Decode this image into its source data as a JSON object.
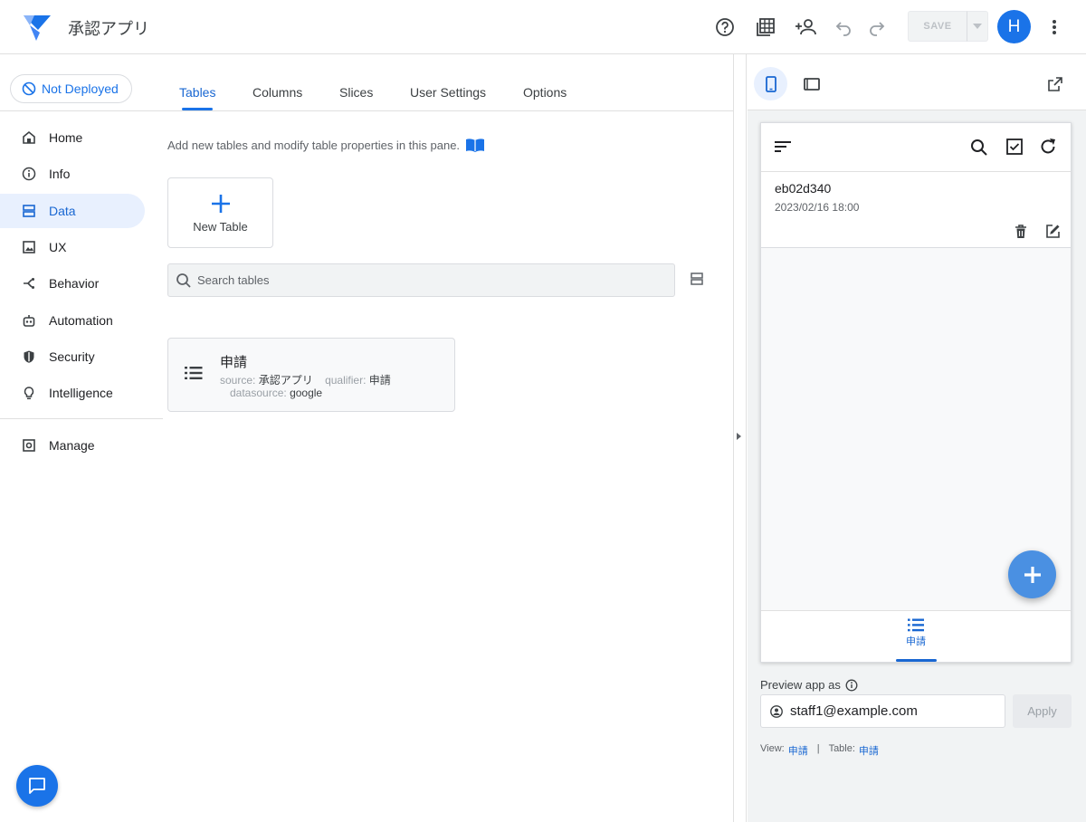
{
  "app": {
    "title": "承認アプリ"
  },
  "topbar": {
    "icons": [
      "help-icon",
      "table-grid-icon",
      "add-person-icon",
      "undo-icon",
      "redo-icon"
    ],
    "save_label": "SAVE",
    "avatar_initial": "H"
  },
  "sidebar": {
    "deploy_status": "Not Deployed",
    "items": [
      {
        "label": "Home",
        "icon": "home-icon"
      },
      {
        "label": "Info",
        "icon": "info-icon"
      },
      {
        "label": "Data",
        "icon": "data-icon",
        "active": true
      },
      {
        "label": "UX",
        "icon": "image-icon"
      },
      {
        "label": "Behavior",
        "icon": "behavior-icon"
      },
      {
        "label": "Automation",
        "icon": "robot-icon"
      },
      {
        "label": "Security",
        "icon": "shield-icon"
      },
      {
        "label": "Intelligence",
        "icon": "bulb-icon"
      }
    ],
    "manage_label": "Manage"
  },
  "tabs": [
    {
      "label": "Tables",
      "active": true
    },
    {
      "label": "Columns"
    },
    {
      "label": "Slices"
    },
    {
      "label": "User Settings"
    },
    {
      "label": "Options"
    }
  ],
  "main": {
    "hint": "Add new tables and modify table properties in this pane.",
    "new_table_label": "New Table",
    "search_placeholder": "Search tables",
    "table": {
      "name": "申請",
      "source_label": "source:",
      "source": "承認アプリ",
      "qualifier_label": "qualifier:",
      "qualifier": "申請",
      "datasource_label": "datasource:",
      "datasource": "google"
    }
  },
  "preview": {
    "record": {
      "id": "eb02d340",
      "date": "2023/02/16 18:00"
    },
    "bottom_tab": "申請",
    "preview_as_label": "Preview app as",
    "preview_as_value": "staff1@example.com",
    "apply_label": "Apply",
    "view_label": "View:",
    "view_value": "申請",
    "separator": "|",
    "table_label": "Table:",
    "table_value": "申請"
  },
  "colors": {
    "accent": "#1a73e8",
    "active_bg": "#e8f0fe",
    "fab": "#4a90e2"
  }
}
